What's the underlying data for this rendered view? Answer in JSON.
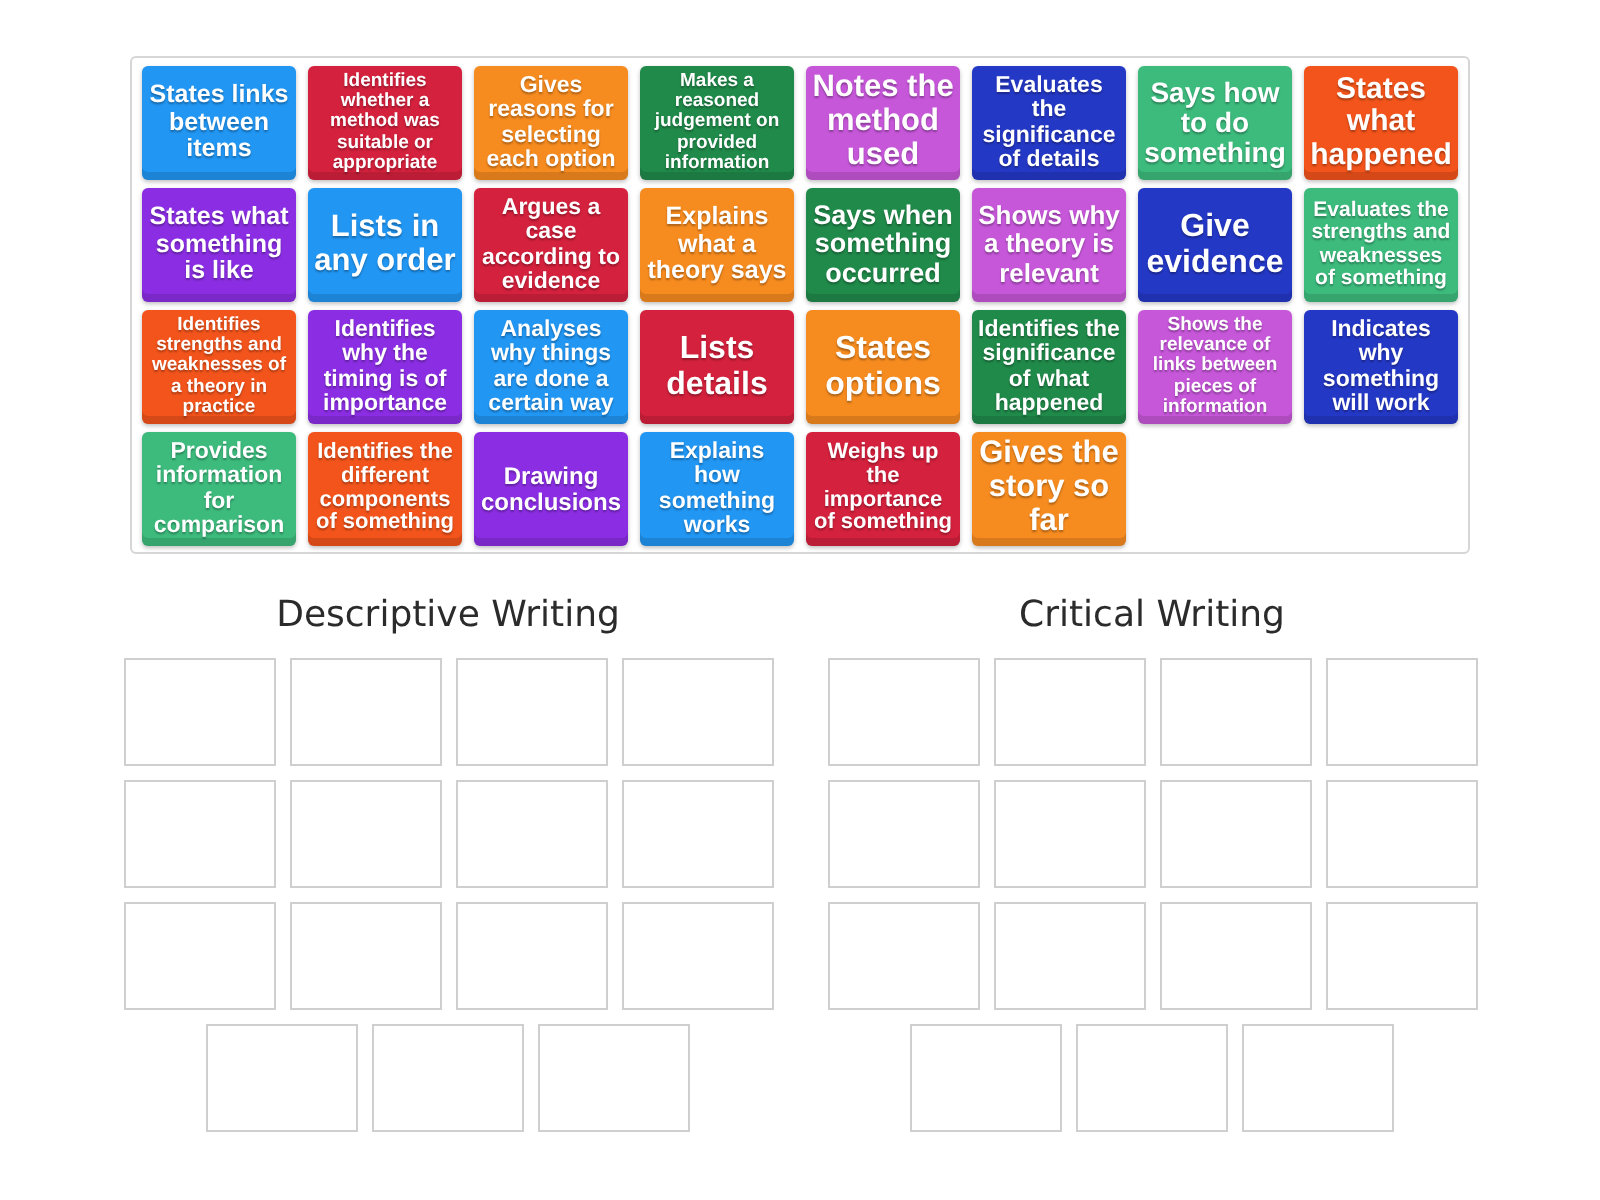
{
  "tiles": [
    {
      "text": "States links between items",
      "color": "#2196f3"
    },
    {
      "text": "Identifies whether a method was suitable or appropriate",
      "color": "#d4213d"
    },
    {
      "text": "Gives reasons for selecting each option",
      "color": "#f68b1f"
    },
    {
      "text": "Makes a reasoned judgement on provided information",
      "color": "#208a4a"
    },
    {
      "text": "Notes the method used",
      "color": "#c657d9"
    },
    {
      "text": "Evaluates the significance of details",
      "color": "#2438c6"
    },
    {
      "text": "Says how to do something",
      "color": "#3dbb7d"
    },
    {
      "text": "States what happened",
      "color": "#f2541b"
    },
    {
      "text": "States what something is like",
      "color": "#8b2ee3"
    },
    {
      "text": "Lists in any order",
      "color": "#2196f3"
    },
    {
      "text": "Argues a case according to evidence",
      "color": "#d4213d"
    },
    {
      "text": "Explains what a theory says",
      "color": "#f68b1f"
    },
    {
      "text": "Says when something occurred",
      "color": "#208a4a"
    },
    {
      "text": "Shows why a theory is relevant",
      "color": "#c657d9"
    },
    {
      "text": "Give evidence",
      "color": "#2438c6"
    },
    {
      "text": "Evaluates the strengths and weaknesses of something",
      "color": "#3dbb7d"
    },
    {
      "text": "Identifies strengths and weaknesses of a theory in practice",
      "color": "#f2541b"
    },
    {
      "text": "Identifies why the timing is of importance",
      "color": "#8b2ee3"
    },
    {
      "text": "Analyses why things are done a certain way",
      "color": "#2196f3"
    },
    {
      "text": "Lists details",
      "color": "#d4213d"
    },
    {
      "text": "States options",
      "color": "#f68b1f"
    },
    {
      "text": "Identifies the significance of what happened",
      "color": "#208a4a"
    },
    {
      "text": "Shows the relevance of links between pieces of information",
      "color": "#c657d9"
    },
    {
      "text": "Indicates why something will work",
      "color": "#2438c6"
    },
    {
      "text": "Provides information for comparison",
      "color": "#3dbb7d"
    },
    {
      "text": "Identifies the different components of something",
      "color": "#f2541b"
    },
    {
      "text": "Drawing conclusions",
      "color": "#8b2ee3"
    },
    {
      "text": "Explains how something works",
      "color": "#2196f3"
    },
    {
      "text": "Weighs up the importance of something",
      "color": "#d4213d"
    },
    {
      "text": "Gives the story so far",
      "color": "#f68b1f"
    }
  ],
  "groups": [
    {
      "title": "Descriptive Writing"
    },
    {
      "title": "Critical Writing"
    }
  ]
}
